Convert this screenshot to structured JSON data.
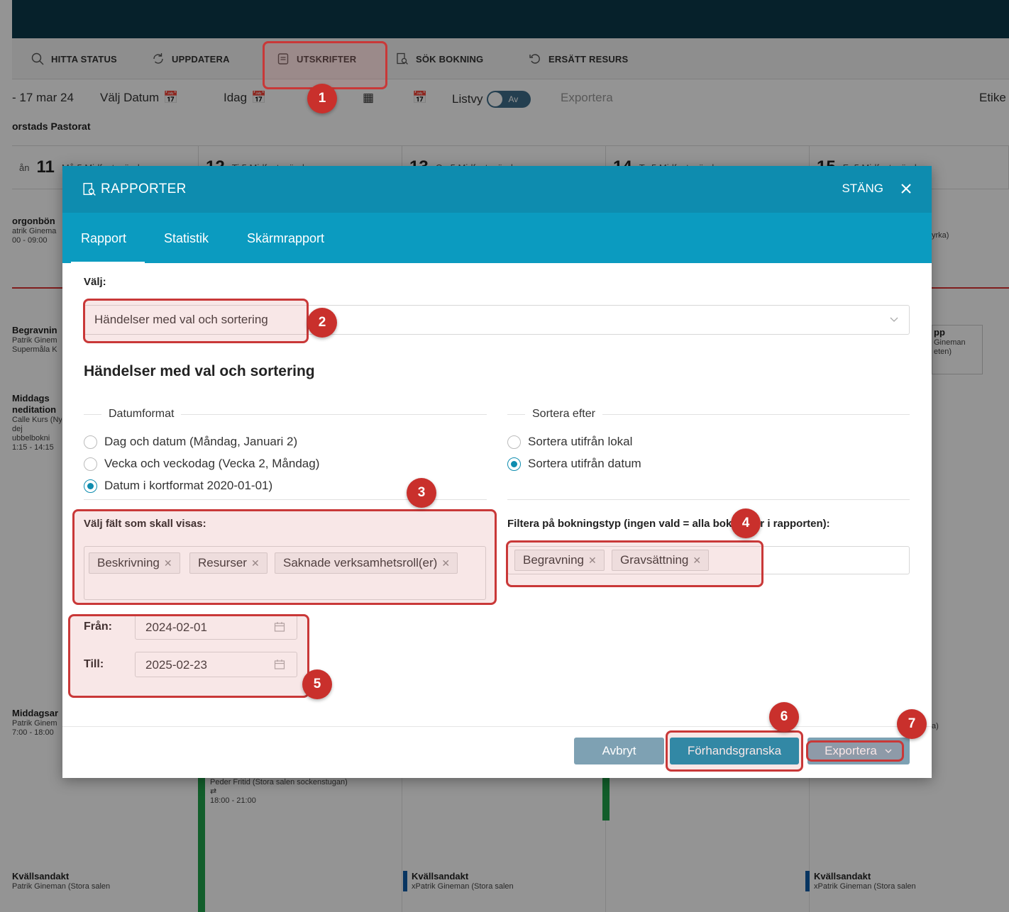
{
  "toolbar": {
    "items": [
      {
        "label": "HITTA STATUS"
      },
      {
        "label": "UPPDATERA"
      },
      {
        "label": "UTSKRIFTER"
      },
      {
        "label": "SÖK BOKNING"
      },
      {
        "label": "ERSÄTT RESURS"
      }
    ]
  },
  "datebar": {
    "range": "- 17 mar 24",
    "choose_date": "Välj Datum",
    "today": "Idag",
    "list_view": "Listvy",
    "toggle": "Av",
    "export": "Exportera",
    "label_cut": "Etike"
  },
  "org": "orstads Pastorat",
  "week": [
    {
      "pre": "ån",
      "num": "11",
      "text": "Må 5 Midfastosönd"
    },
    {
      "pre": "",
      "num": "12",
      "text": "Ti 5 Midfastosönd"
    },
    {
      "pre": "",
      "num": "13",
      "text": "On 5 Midfastosönd"
    },
    {
      "pre": "",
      "num": "14",
      "text": "To 5 Midfastosönd"
    },
    {
      "pre": "",
      "num": "15",
      "text": "Fr 5 Midfastosönd"
    }
  ],
  "events": {
    "e1": {
      "title": "orgonbön",
      "line1": "atrik Ginema",
      "line2": "00 - 09:00"
    },
    "e2": {
      "title": "Begravnin",
      "line1": "Patrik Ginem",
      "line2": "Supermåla K"
    },
    "e3": {
      "title": "Middags",
      "line1": "neditation",
      "line2": "Calle Kurs (Ny",
      "line3": "dej",
      "line4": "ubbelbokni",
      "line5": "1:15 - 14:15"
    },
    "e4": {
      "title": "Middagsar",
      "line1": "Patrik Ginem",
      "line2": "7:00 - 18:00"
    },
    "e5": {
      "title": "Kvällsandakt",
      "line1": "Patrik Gineman (Stora salen"
    },
    "e6": {
      "line1": "Peder Fritid (Stora salen sockenstugan)",
      "line2": "18:00 - 21:00"
    },
    "e7": {
      "title": "Kvällsandakt",
      "line1": "xPatrik Gineman (Stora salen"
    },
    "e8": {
      "title": "Kvällsandakt",
      "line1": "xPatrik Gineman (Stora salen"
    },
    "r1": {
      "line1": "yrka)"
    },
    "r2": {
      "title": "pp",
      "line1": "Gineman",
      "line2": "eten)"
    },
    "r3": {
      "line1": "a)"
    }
  },
  "modal": {
    "title": "RAPPORTER",
    "close_label": "STÄNG",
    "tabs": [
      "Rapport",
      "Statistik",
      "Skärmrapport"
    ],
    "choose_label": "Välj:",
    "report_select": "Händelser med val och sortering",
    "section_title": "Händelser med val och sortering",
    "date_format_legend": "Datumformat",
    "date_formats": [
      "Dag och datum (Måndag, Januari 2)",
      "Vecka och veckodag (Vecka 2, Måndag)",
      "Datum i kortformat 2020-01-01)"
    ],
    "date_format_selected": 2,
    "sort_legend": "Sortera efter",
    "sort_options": [
      "Sortera utifrån lokal",
      "Sortera utifrån datum"
    ],
    "sort_selected": 1,
    "fields_label": "Välj fält som skall visas:",
    "fields_tags": [
      "Beskrivning",
      "Resurser",
      "Saknade verksamhetsroll(er)"
    ],
    "filter_label": "Filtera på bokningstyp (ingen vald = alla bokningar i rapporten):",
    "filter_tags": [
      "Begravning",
      "Gravsättning"
    ],
    "from_label": "Från:",
    "from_value": "2024-02-01",
    "to_label": "Till:",
    "to_value": "2025-02-23",
    "cancel": "Avbryt",
    "preview": "Förhandsgranska",
    "export": "Exportera"
  },
  "annotations": [
    "1",
    "2",
    "3",
    "4",
    "5",
    "6",
    "7"
  ],
  "colors": {
    "header": "#0e8caf",
    "tabs": "#0b9bc0",
    "topbar": "#0c3a4a",
    "highlight": "#c93838",
    "badge": "#c9302c"
  }
}
